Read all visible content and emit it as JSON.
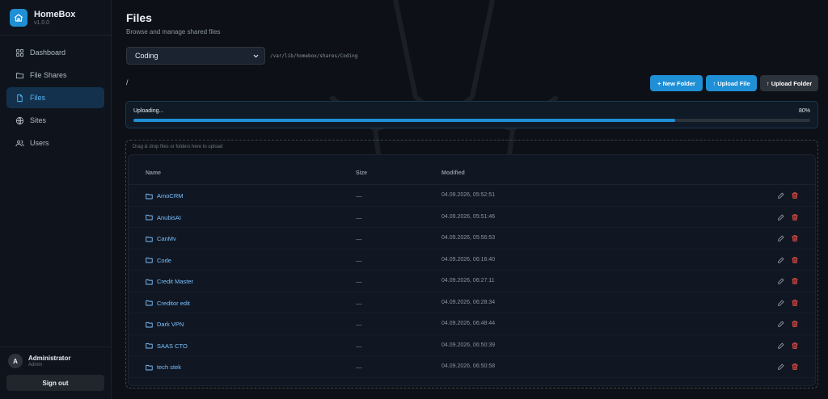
{
  "app": {
    "name": "HomeBox",
    "version": "v1.0.0"
  },
  "sidebar": {
    "items": [
      {
        "label": "Dashboard",
        "icon": "grid-icon",
        "active": false
      },
      {
        "label": "File Shares",
        "icon": "folder-icon",
        "active": false
      },
      {
        "label": "Files",
        "icon": "file-icon",
        "active": true
      },
      {
        "label": "Sites",
        "icon": "globe-icon",
        "active": false
      },
      {
        "label": "Users",
        "icon": "users-icon",
        "active": false
      }
    ],
    "user": {
      "initial": "A",
      "name": "Administrator",
      "role": "Admin"
    },
    "signout_label": "Sign out"
  },
  "page": {
    "title": "Files",
    "subtitle": "Browse and manage shared files"
  },
  "share": {
    "selected": "Coding",
    "path": "/var/lib/homebox/shares/Coding"
  },
  "breadcrumb": "/",
  "toolbar": {
    "new_folder": "+ New Folder",
    "upload_file": "↑ Upload File",
    "upload_folder": "↑ Upload Folder"
  },
  "upload": {
    "label": "Uploading...",
    "percent_label": "80%",
    "fraction": 0.8
  },
  "dropzone": {
    "hint": "Drag & drop files or folders here to upload"
  },
  "table": {
    "columns": [
      "Name",
      "Size",
      "Modified"
    ],
    "rows": [
      {
        "name": "AmoCRM",
        "size": "—",
        "modified": "04.09.2026, 05:52:51"
      },
      {
        "name": "AnubisAI",
        "size": "—",
        "modified": "04.09.2026, 05:51:46"
      },
      {
        "name": "CanMv",
        "size": "—",
        "modified": "04.09.2026, 05:56:53"
      },
      {
        "name": "Code",
        "size": "—",
        "modified": "04.09.2026, 06:16:40"
      },
      {
        "name": "Credit Master",
        "size": "—",
        "modified": "04.09.2026, 06:27:11"
      },
      {
        "name": "Creditor edit",
        "size": "—",
        "modified": "04.09.2026, 06:28:34"
      },
      {
        "name": "Dark VPN",
        "size": "—",
        "modified": "04.09.2026, 06:48:44"
      },
      {
        "name": "SAAS CTO",
        "size": "—",
        "modified": "04.09.2026, 06:50:39"
      },
      {
        "name": "tech stek",
        "size": "—",
        "modified": "04.09.2026, 06:50:58"
      }
    ]
  },
  "colors": {
    "accent": "#1f8fd6",
    "danger": "#f85149",
    "link": "#79c0ff"
  }
}
